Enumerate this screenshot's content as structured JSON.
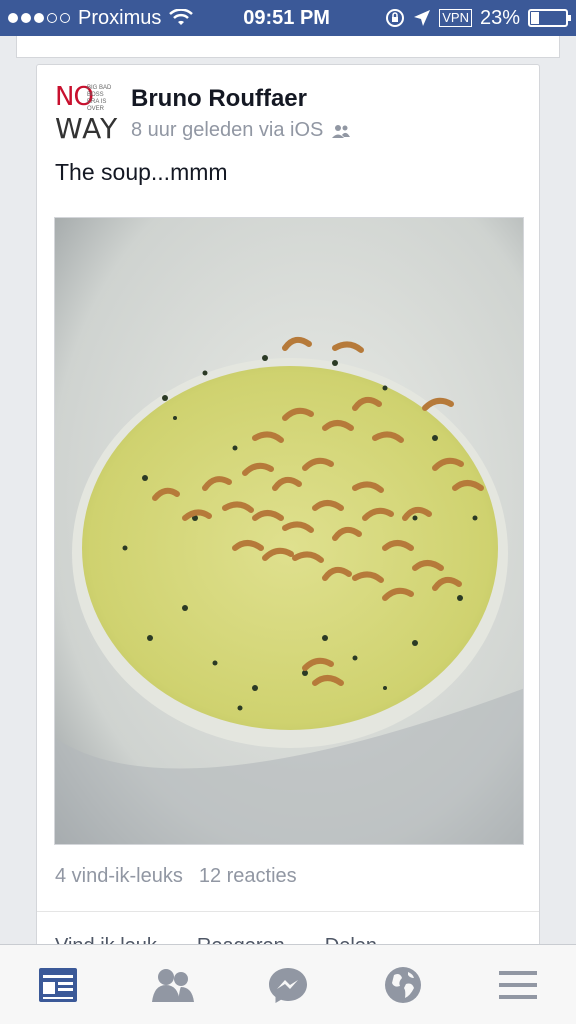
{
  "status_bar": {
    "carrier": "Proximus",
    "time": "09:51 PM",
    "vpn": "VPN",
    "battery": "23%",
    "battery_level": 0.23
  },
  "post": {
    "author": "Bruno Rouffaer",
    "avatar_logo": {
      "top": "NO",
      "small": "BIG BAD BOSS ERA IS OVER",
      "bottom": "WAY"
    },
    "meta": "8 uur geleden via iOS",
    "text": "The soup...mmm",
    "likes": "4 vind-ik-leuks",
    "comments": "12 reacties",
    "actions": [
      "Vind ik leuk",
      "Reageren",
      "Delen"
    ]
  },
  "tabbar": {
    "tabs": [
      "news-feed-icon",
      "friend-requests-icon",
      "messenger-icon",
      "notifications-globe-icon",
      "more-menu-icon"
    ],
    "active_color": "#3b5998",
    "inactive_color": "#9197a3"
  }
}
